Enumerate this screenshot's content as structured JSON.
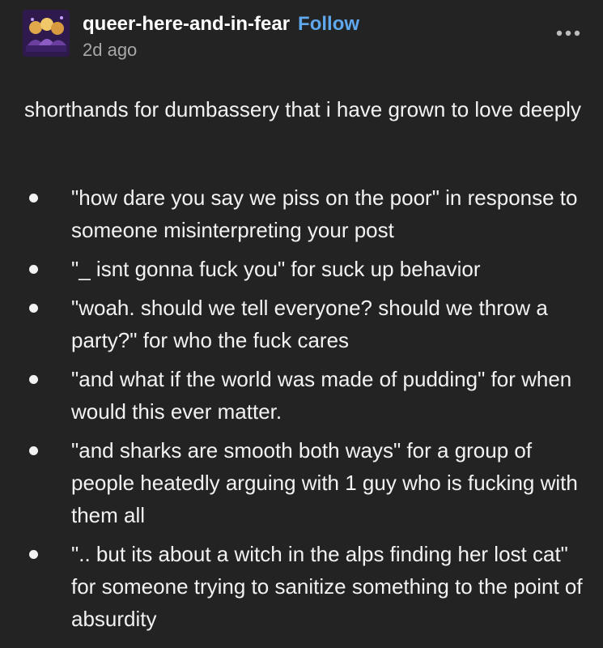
{
  "post": {
    "username": "queer-here-and-in-fear",
    "follow_label": "Follow",
    "timestamp": "2d ago",
    "avatar_icon": "avatar-group-icon",
    "more_icon": "more-options-icon",
    "body": "shorthands for dumbassery that i have grown to love deeply",
    "list": [
      "\"how dare you say we piss on the poor\" in response to someone misinterpreting your post",
      "\"_ isnt gonna fuck you\" for suck up behavior",
      "\"woah. should we tell everyone? should we throw a party?\" for who the fuck cares",
      "\"and what if the world was made of pudding\" for when would this ever matter.",
      "\"and sharks are smooth both ways\" for a group of people heatedly arguing with 1 guy who is fucking with them all",
      "\".. but its about a witch in the alps finding her lost cat\" for someone trying to sanitize something to the point of absurdity"
    ]
  },
  "colors": {
    "background": "#232323",
    "text": "#f2f2f2",
    "follow": "#5fa8ee",
    "muted": "#a8a8a8"
  }
}
